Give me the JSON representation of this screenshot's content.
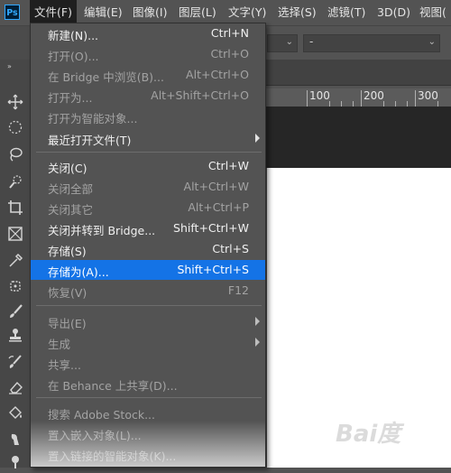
{
  "app": {
    "logo": "Ps"
  },
  "menubar": {
    "file": "文件(F)",
    "edit": "编辑(E)",
    "image": "图像(I)",
    "layer": "图层(L)",
    "type": "文字(Y)",
    "select": "选择(S)",
    "filter": "滤镜(T)",
    "three_d": "3D(D)",
    "view": "视图("
  },
  "options_bar": {
    "dropdown_value": "-"
  },
  "ruler": {
    "labels": [
      "100",
      "200",
      "300"
    ]
  },
  "file_menu": [
    {
      "label": "新建(N)...",
      "shortcut": "Ctrl+N",
      "enabled": true
    },
    {
      "label": "打开(O)...",
      "shortcut": "Ctrl+O",
      "enabled": false
    },
    {
      "label": "在 Bridge 中浏览(B)...",
      "shortcut": "Alt+Ctrl+O",
      "enabled": false
    },
    {
      "label": "打开为...",
      "shortcut": "Alt+Shift+Ctrl+O",
      "enabled": false
    },
    {
      "label": "打开为智能对象...",
      "shortcut": "",
      "enabled": false
    },
    {
      "label": "最近打开文件(T)",
      "shortcut": "",
      "enabled": true,
      "submenu": true
    },
    {
      "label": "关闭(C)",
      "shortcut": "Ctrl+W",
      "enabled": true
    },
    {
      "label": "关闭全部",
      "shortcut": "Alt+Ctrl+W",
      "enabled": false
    },
    {
      "label": "关闭其它",
      "shortcut": "Alt+Ctrl+P",
      "enabled": false
    },
    {
      "label": "关闭并转到 Bridge...",
      "shortcut": "Shift+Ctrl+W",
      "enabled": true
    },
    {
      "label": "存储(S)",
      "shortcut": "Ctrl+S",
      "enabled": true
    },
    {
      "label": "存储为(A)...",
      "shortcut": "Shift+Ctrl+S",
      "enabled": true,
      "highlighted": true
    },
    {
      "label": "恢复(V)",
      "shortcut": "F12",
      "enabled": false
    },
    {
      "label": "导出(E)",
      "shortcut": "",
      "enabled": false,
      "submenu": true
    },
    {
      "label": "生成",
      "shortcut": "",
      "enabled": false,
      "submenu": true
    },
    {
      "label": "共享...",
      "shortcut": "",
      "enabled": false
    },
    {
      "label": "在 Behance 上共享(D)...",
      "shortcut": "",
      "enabled": false
    },
    {
      "label": "搜索 Adobe Stock...",
      "shortcut": "",
      "enabled": false
    },
    {
      "label": "置入嵌入对象(L)...",
      "shortcut": "",
      "enabled": false
    },
    {
      "label": "置入链接的智能对象(K)...",
      "shortcut": "",
      "enabled": false
    }
  ],
  "watermark": {
    "text": "Bai度"
  },
  "colors": {
    "highlight": "#1473e6",
    "menu_bg": "#535353",
    "canvas": "#ffffff"
  }
}
